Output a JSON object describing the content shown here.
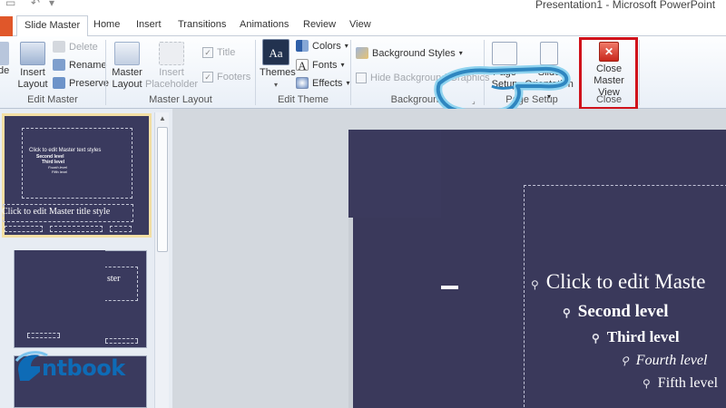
{
  "window": {
    "title": "Presentation1  -  Microsoft PowerPoint"
  },
  "tabs": [
    {
      "label": "Slide Master",
      "active": true
    },
    {
      "label": "Home"
    },
    {
      "label": "Insert"
    },
    {
      "label": "Transitions"
    },
    {
      "label": "Animations"
    },
    {
      "label": "Review"
    },
    {
      "label": "View"
    }
  ],
  "ribbon": {
    "edit_master": {
      "group_label": "Edit Master",
      "slide_partial": "de",
      "insert_layout_line1": "Insert",
      "insert_layout_line2": "Layout",
      "delete": "Delete",
      "rename": "Rename",
      "preserve": "Preserve"
    },
    "master_layout": {
      "group_label": "Master Layout",
      "master_layout_line1": "Master",
      "master_layout_line2": "Layout",
      "insert_placeholder_line1": "Insert",
      "insert_placeholder_line2": "Placeholder",
      "title": "Title",
      "footers": "Footers"
    },
    "edit_theme": {
      "group_label": "Edit Theme",
      "themes": "Themes",
      "colors": "Colors",
      "fonts": "Fonts",
      "effects": "Effects"
    },
    "background": {
      "group_label": "Background",
      "background_styles": "Background Styles",
      "hide_background_graphics": "Hide Background Graphics"
    },
    "page_setup": {
      "group_label": "Page Setup",
      "page_setup_line1": "Page",
      "page_setup_line2": "Setup",
      "slide_orientation_line1": "Slide",
      "slide_orientation_line2": "Orientation"
    },
    "close": {
      "group_label": "Close",
      "close_master_view_line1": "Close",
      "close_master_view_line2": "Master View"
    }
  },
  "thumbnails": {
    "master": {
      "level1": "Click to edit Master text styles",
      "level2": "Second level",
      "level3": "Third level",
      "level4": "Fourth level",
      "level5": "Fifth level",
      "title": "Click to edit Master title style"
    },
    "layout": {
      "title_fragment": "ster"
    }
  },
  "slide": {
    "bullets": [
      {
        "text": "Click to edit Maste",
        "level": 1
      },
      {
        "text": "Second level",
        "level": 2
      },
      {
        "text": "Third level",
        "level": 3
      },
      {
        "text": "Fourth level",
        "level": 4
      },
      {
        "text": "Fifth level",
        "level": 5
      }
    ]
  },
  "logo": {
    "text": "ntbook"
  },
  "colors": {
    "slide_background": "#3a395b",
    "highlight_box": "#d0121b",
    "pointer_outline": "#3aa9d6",
    "logo_blue": "#0e6bb6"
  }
}
